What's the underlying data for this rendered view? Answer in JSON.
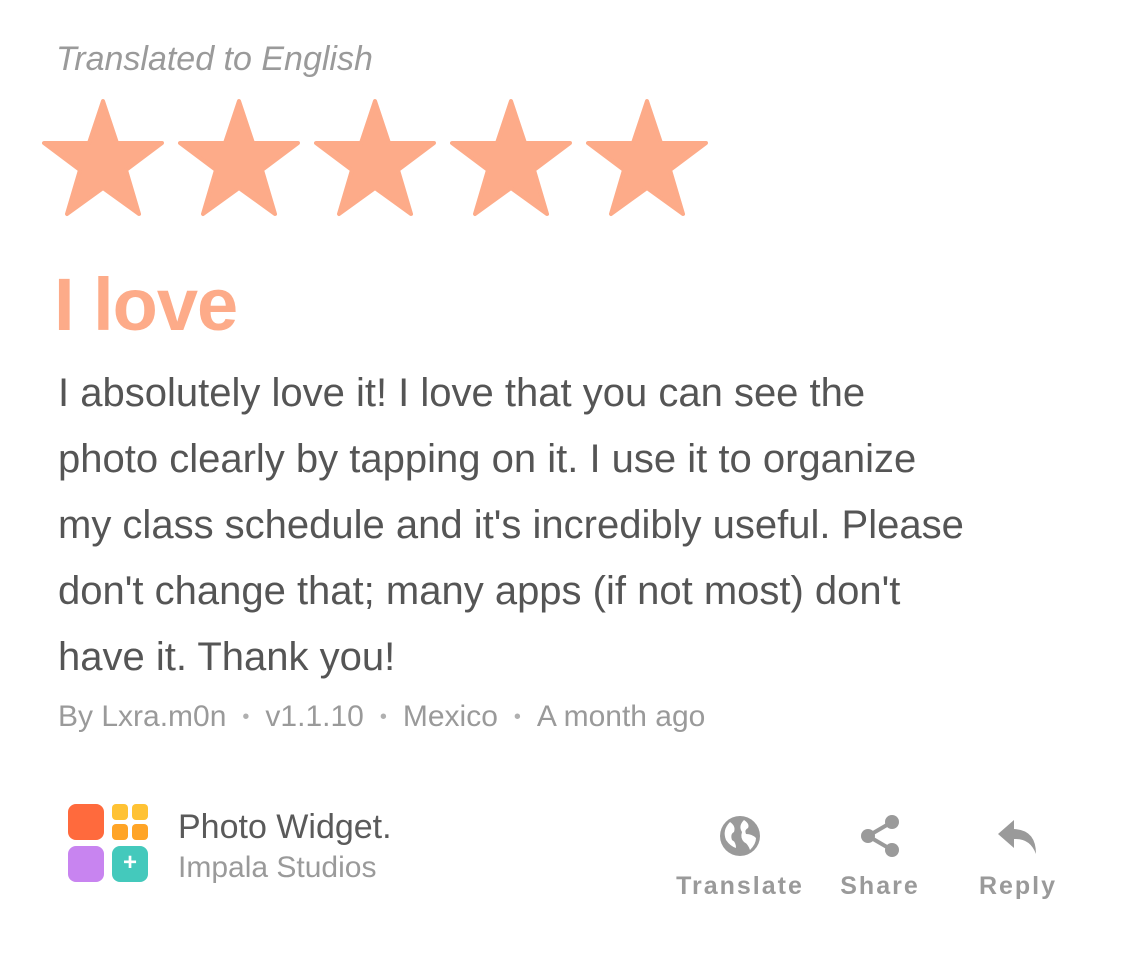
{
  "translated_note": "Translated to English",
  "rating": {
    "value": 5,
    "max": 5,
    "color": "#fdab89"
  },
  "review": {
    "title": "I love",
    "body_lines": [
      "I absolutely love it! I love that you can see the",
      "photo clearly by tapping on it. I use it to organize",
      "my class schedule and it's incredibly useful. Please",
      "don't change that; many apps (if not most) don't",
      "have it. Thank you!"
    ]
  },
  "meta": {
    "author": "By Lxra.m0n",
    "version": "v1.1.10",
    "country": "Mexico",
    "time": "A month ago",
    "separator": "•"
  },
  "app": {
    "name": "Photo Widget.",
    "developer": "Impala Studios",
    "icon_plus": "+"
  },
  "actions": {
    "translate": {
      "label": "Translate",
      "icon": "globe-icon"
    },
    "share": {
      "label": "Share",
      "icon": "share-icon"
    },
    "reply": {
      "label": "Reply",
      "icon": "reply-icon"
    }
  },
  "colors": {
    "accent": "#fdab89",
    "text": "#555555",
    "muted": "#9a9a9a"
  }
}
